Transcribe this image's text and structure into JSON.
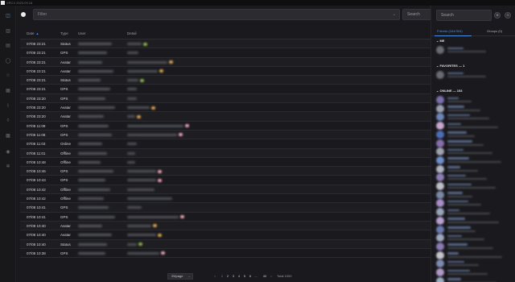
{
  "window": {
    "title": "VRCX 2023.09.18"
  },
  "colors": {
    "accent": "#4a90e2",
    "status_pill": "#8ab04c",
    "location_pill": "#e8a0b0",
    "avatar_pill": "#d8a050"
  },
  "nav": {
    "items": [
      {
        "icon": "feed-icon",
        "glyph": "◫",
        "active": true
      },
      {
        "icon": "chart-icon",
        "glyph": "▥"
      },
      {
        "icon": "notes-icon",
        "glyph": "▤"
      },
      {
        "icon": "search-icon",
        "glyph": "◯"
      },
      {
        "icon": "star-icon",
        "glyph": "☆"
      },
      {
        "icon": "book-icon",
        "glyph": "▦"
      },
      {
        "icon": "graph-icon",
        "glyph": "⌇"
      },
      {
        "icon": "bell-icon",
        "glyph": "◊"
      },
      {
        "icon": "gallery-icon",
        "glyph": "▩"
      },
      {
        "icon": "user-icon",
        "glyph": "◉"
      },
      {
        "icon": "gear-icon",
        "glyph": "✲"
      }
    ]
  },
  "toolbar": {
    "filter_placeholder": "Filter",
    "search_label": "Search"
  },
  "table": {
    "headers": {
      "date": "Date",
      "type": "Type",
      "user": "User",
      "detail": "Detail"
    },
    "rows": [
      {
        "date": "07/08 23:21",
        "type": "Status"
      },
      {
        "date": "07/08 23:21",
        "type": "GPS"
      },
      {
        "date": "07/08 23:21",
        "type": "Avatar"
      },
      {
        "date": "07/08 23:21",
        "type": "Avatar"
      },
      {
        "date": "07/08 23:21",
        "type": "Status"
      },
      {
        "date": "07/08 23:21",
        "type": "GPS"
      },
      {
        "date": "07/08 23:20",
        "type": "GPS"
      },
      {
        "date": "07/08 23:20",
        "type": "Avatar"
      },
      {
        "date": "07/08 23:20",
        "type": "Avatar"
      },
      {
        "date": "07/08 11:09",
        "type": "GPS"
      },
      {
        "date": "07/08 11:08",
        "type": "GPS"
      },
      {
        "date": "07/08 11:03",
        "type": "Online"
      },
      {
        "date": "07/08 11:01",
        "type": "Offline"
      },
      {
        "date": "07/08 10:48",
        "type": "Offline"
      },
      {
        "date": "07/08 10:46",
        "type": "GPS"
      },
      {
        "date": "07/08 10:43",
        "type": "GPS"
      },
      {
        "date": "07/08 10:42",
        "type": "Offline"
      },
      {
        "date": "07/08 10:42",
        "type": "Offline"
      },
      {
        "date": "07/08 10:41",
        "type": "GPS"
      },
      {
        "date": "07/08 10:41",
        "type": "GPS"
      },
      {
        "date": "07/08 10:40",
        "type": "Avatar"
      },
      {
        "date": "07/08 10:40",
        "type": "Avatar"
      },
      {
        "date": "07/08 10:40",
        "type": "Status"
      },
      {
        "date": "07/08 10:38",
        "type": "GPS"
      }
    ]
  },
  "pagination": {
    "page_size": "25/page",
    "prev": "<",
    "pages": [
      "1",
      "2",
      "3",
      "4",
      "5",
      "6",
      "...",
      "40"
    ],
    "next": ">",
    "total": "Total 1000"
  },
  "sidebar": {
    "search_placeholder": "Search",
    "tabs": [
      "Friends (164/304)",
      "Groups (0)"
    ],
    "groups": {
      "me": "ME",
      "favorites": "FAVORITES — 1",
      "online": "ONLINE — 153"
    }
  }
}
